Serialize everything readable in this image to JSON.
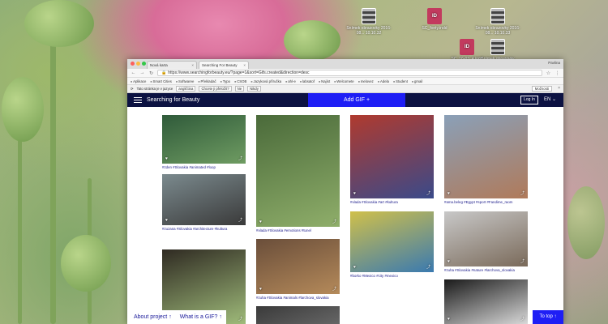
{
  "desktop": {
    "icons": [
      {
        "label": "Snímek obrazovky 2016-08... 10.10.32",
        "kind": "img"
      },
      {
        "label": "SC_fonty.indd",
        "kind": "id"
      },
      {
        "label": "Snímek obrazovky 2016-08... 10.10.33",
        "kind": "img"
      },
      {
        "label": "SC_16-03_4.indd",
        "kind": "id"
      },
      {
        "label": "Snímek obrazovky",
        "kind": "img"
      }
    ]
  },
  "browser": {
    "tabs": [
      {
        "title": "Nová karta",
        "close": "×"
      },
      {
        "title": "Searching For Beauty",
        "close": "×"
      }
    ],
    "user": "Pavlina",
    "url": "https://www.searchingforbeauty.eu/?page=1&sort=Gifs.created&direction=desc",
    "bookmarks": [
      "Aplikace",
      "Smart Cities",
      "Softwaree",
      "Překladač",
      "Typo",
      "CSOB",
      "Jazyková příručka",
      "ahl-e",
      "labsatof",
      "Najíst",
      "Welcomete",
      "melovez",
      "Adela",
      "Student",
      "gmail"
    ],
    "translate": {
      "prompt": "Tato stránka je v jazyce",
      "lang": "angličtina",
      "question": "Chcete ji přeložit?",
      "no": "Ne",
      "never": "Nikdy",
      "options": "Možnosti"
    }
  },
  "site": {
    "brand": "Searching for Beauty",
    "add_gif": "Add GIF +",
    "login": "Log In",
    "lang": "EN ⌄",
    "about": "About project ↑",
    "what_gif": "What is a GIF? ↑",
    "to_top": "To top ↑"
  },
  "cards": [
    {
      "tags": "#zden #Slovakia #animated #loop",
      "colors": [
        "#2f5a3a",
        "#6f9c62"
      ]
    },
    {
      "tags": "#zuzana #Slovakia #architecture #kultura",
      "colors": [
        "#7b8a8e",
        "#3a3a3a"
      ]
    },
    {
      "tags": "",
      "colors": [
        "#2f2a22",
        "#9fbb7a"
      ]
    },
    {
      "tags": "#vlada #Slovakia #emotions #tunel",
      "colors": [
        "#4a6a3a",
        "#8fae6a"
      ]
    },
    {
      "tags": "#zuha #Slovakia #animals #larchova_slovakia",
      "colors": [
        "#6a4e3a",
        "#b58a5a"
      ]
    },
    {
      "tags": "",
      "colors": [
        "#3a3a3a",
        "#666"
      ]
    },
    {
      "tags": "#vlada #Slovakia #art #kultura",
      "colors": [
        "#b03a2e",
        "#3a4a8a"
      ]
    },
    {
      "tags": "#borko #Mexico #city #mexico",
      "colors": [
        "#d0c04a",
        "#3a7ab0"
      ]
    },
    {
      "tags": "#ama.beleg #Egypt #sport #Fandime_raom",
      "colors": [
        "#8aa0b8",
        "#b07a5a"
      ]
    },
    {
      "tags": "#zuha #Slovakia #nature #larchova_slovakia",
      "colors": [
        "#c8c8c8",
        "#7a6a5a"
      ]
    },
    {
      "tags": "",
      "colors": [
        "#1a1a1a",
        "#d8d8d8"
      ]
    }
  ],
  "card_icons": {
    "heart": "♥",
    "share": "⤴"
  }
}
